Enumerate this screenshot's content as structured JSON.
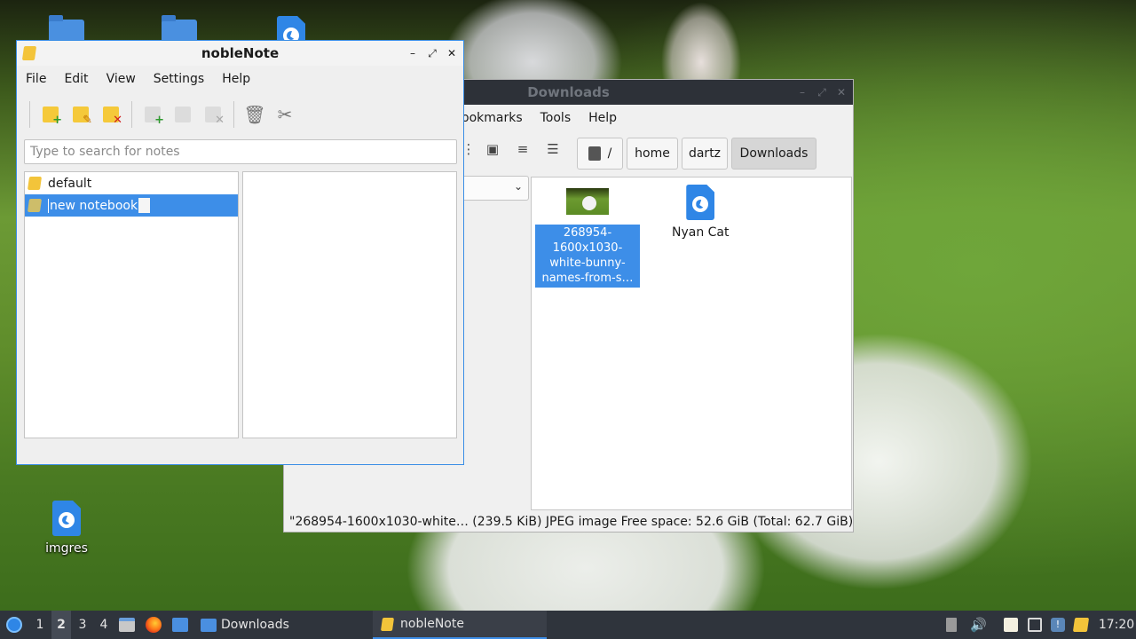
{
  "desktop": {
    "icons": [
      {
        "label": "",
        "type": "folder"
      },
      {
        "label": "",
        "type": "folder-web"
      },
      {
        "label": "",
        "type": "html"
      },
      {
        "label": "imgres",
        "type": "html"
      }
    ]
  },
  "downloads_window": {
    "title": "Downloads",
    "menu": [
      "ookmarks",
      "Tools",
      "Help"
    ],
    "path": [
      "/",
      "home",
      "dartz",
      "Downloads"
    ],
    "files": [
      {
        "name": "268954-1600x1030-white-bunny-names-from-s…",
        "selected": true
      },
      {
        "name": "Nyan Cat",
        "selected": false
      }
    ],
    "status": "\"268954-1600x1030-white… (239.5 KiB) JPEG image    Free space: 52.6 GiB (Total: 62.7 GiB)"
  },
  "noble_window": {
    "title": "nobleNote",
    "menu": [
      "File",
      "Edit",
      "View",
      "Settings",
      "Help"
    ],
    "search_placeholder": "Type to search for notes",
    "notebooks": [
      {
        "label": "default",
        "selected": false
      },
      {
        "label": "new notebook",
        "selected": true,
        "editing": true
      }
    ]
  },
  "taskbar": {
    "workspaces": [
      "1",
      "2",
      "3",
      "4"
    ],
    "active_workspace": "2",
    "tasks": [
      {
        "label": "Downloads",
        "active": false
      },
      {
        "label": "nobleNote",
        "active": true
      }
    ],
    "clock": "17:20"
  },
  "colors": {
    "accent": "#3d8ee8",
    "titlebar_dark": "#2d3138",
    "taskbar": "#2f343c",
    "note_yellow": "#f3c43a"
  }
}
